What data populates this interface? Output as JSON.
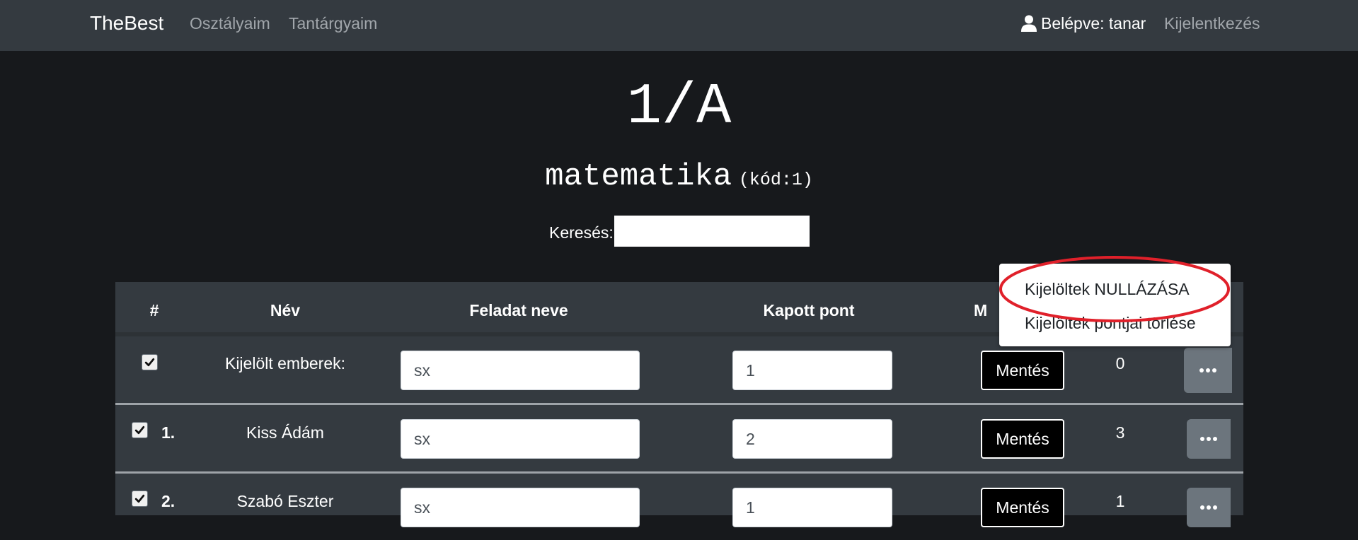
{
  "navbar": {
    "brand": "TheBest",
    "links": [
      "Osztályaim",
      "Tantárgyaim"
    ],
    "user_label": "Belépve: tanar",
    "logout": "Kijelentkezés"
  },
  "page": {
    "class_title": "1/A",
    "subject_name": "matematika",
    "subject_code": "(kód:1)"
  },
  "search": {
    "label": "Keresés:",
    "value": ""
  },
  "table": {
    "headers": [
      "#",
      "Név",
      "Feladat neve",
      "Kapott pont",
      "M"
    ],
    "selected_row": {
      "label": "Kijelölt emberek:",
      "task": "sx",
      "points": "1",
      "save": "Mentés",
      "score": "0"
    },
    "rows": [
      {
        "num": "1.",
        "name": "Kiss Ádám",
        "task": "sx",
        "points": "2",
        "save": "Mentés",
        "score": "3"
      },
      {
        "num": "2.",
        "name": "Szabó Eszter",
        "task": "sx",
        "points": "1",
        "save": "Mentés",
        "score": "1"
      }
    ]
  },
  "dropdown": {
    "items": [
      "Kijelöltek NULLÁZÁSA",
      "Kijelöltek pontjai törlése"
    ]
  },
  "colors": {
    "background": "#17191c",
    "navbar": "#343a40",
    "table": "#343a40",
    "more_button": "#6c757d",
    "highlight": "#e0202a"
  },
  "icons": {
    "user": "user-icon",
    "checkbox": "checkbox-checked-icon",
    "more": "ellipsis-icon"
  }
}
